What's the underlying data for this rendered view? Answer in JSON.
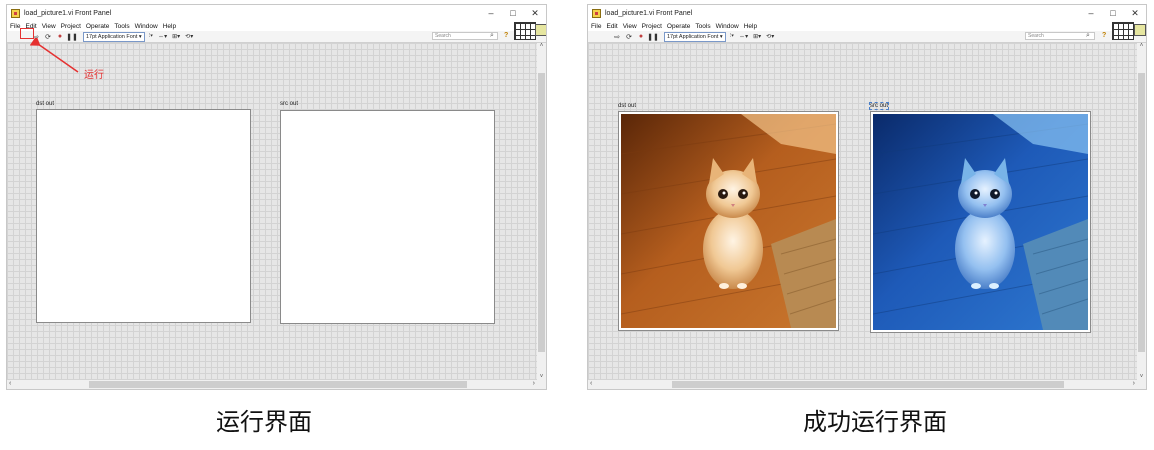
{
  "left_window": {
    "title": "load_picture1.vi Front Panel",
    "window_buttons": [
      "–",
      "□",
      "✕"
    ],
    "menu": [
      "File",
      "Edit",
      "View",
      "Project",
      "Operate",
      "Tools",
      "Window",
      "Help"
    ],
    "toolbar": {
      "font_select": "17pt Application Font",
      "search_placeholder": "Search"
    },
    "dst_label": "dst out",
    "src_label": "src out"
  },
  "right_window": {
    "title": "load_picture1.vi Front Panel",
    "window_buttons": [
      "–",
      "□",
      "✕"
    ],
    "menu": [
      "File",
      "Edit",
      "View",
      "Project",
      "Operate",
      "Tools",
      "Window",
      "Help"
    ],
    "toolbar": {
      "font_select": "17pt Application Font",
      "search_placeholder": "Search"
    },
    "dst_label": "dst out",
    "src_label": "src out"
  },
  "annotation": {
    "run_label": "运行",
    "color": "#e53030"
  },
  "captions": {
    "left": "运行界面",
    "right": "成功运行界面"
  }
}
